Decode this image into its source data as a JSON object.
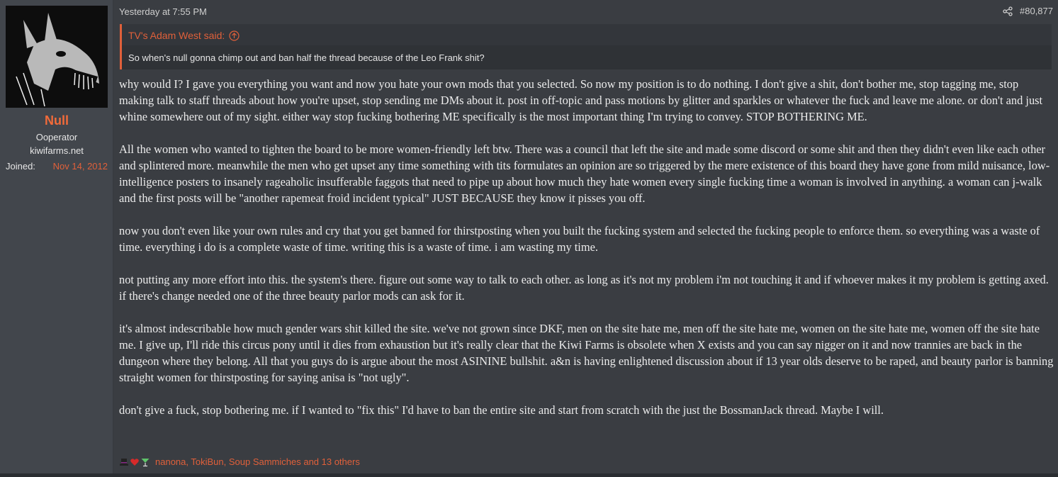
{
  "user": {
    "name": "Null",
    "title": "Ooperator",
    "banner": "kiwifarms.net",
    "joined_label": "Joined:",
    "joined_value": "Nov 14, 2012"
  },
  "post": {
    "date": "Yesterday at 7:55 PM",
    "number": "#80,877",
    "quote_author": "TV's Adam West said:",
    "quote_text": "So when's null gonna chimp out and ban half the thread because of the Leo Frank shit?",
    "paragraphs": [
      "why would I? I gave you everything you want and now you hate your own mods that you selected. So now my position is to do nothing. I don't give a shit, don't bother me, stop tagging me, stop making talk to staff threads about how you're upset, stop sending me DMs about it. post in off-topic and pass motions by glitter and sparkles or whatever the fuck and leave me alone. or don't and just whine somewhere out of my sight. either way stop fucking bothering ME specifically is the most important thing I'm trying to convey. STOP BOTHERING ME.",
      "All the women who wanted to tighten the board to be more women-friendly left btw. There was a council that left the site and made some discord or some shit and then they didn't even like each other and splintered more. meanwhile the men who get upset any time something with tits formulates an opinion are so triggered by the mere existence of this board they have gone from mild nuisance, low-intelligence posters to insanely rageaholic insufferable faggots that need to pipe up about how much they hate women every single fucking time a woman is involved in anything. a woman can j-walk and the first posts will be \"another rapemeat froid incident typical\" JUST BECAUSE they know it pisses you off.",
      "now you don't even like your own rules and cry that you get banned for thirstposting when you built the fucking system and selected the fucking people to enforce them. so everything was a waste of time. everything i do is a complete waste of time. writing this is a waste of time. i am wasting my time.",
      "not putting any more effort into this. the system's there. figure out some way to talk to each other. as long as it's not my problem i'm not touching it and if whoever makes it my problem is getting axed. if there's change needed one of the three beauty parlor mods can ask for it.",
      "it's almost indescribable how much gender wars shit killed the site. we've not grown since DKF, men on the site hate me, men off the site hate me, women on the site hate me, women off the site hate me. I give up, I'll ride this circus pony until it dies from exhaustion but it's really clear that the Kiwi Farms is obsolete when X exists and you can say nigger on it and now trannies are back in the dungeon where they belong. All that you guys do is argue about the most ASININE bullshit. a&n is having enlightened discussion about if 13 year olds deserve to be raped, and beauty parlor is banning straight women for thirstposting for saying anisa is \"not ugly\".",
      "don't give a fuck, stop bothering me. if I wanted to \"fix this\" I'd have to ban the entire site and start from scratch with the just the BossmanJack thread. Maybe I will."
    ],
    "reactions_users": "nanona, TokiBun, Soup Sammiches and 13 others",
    "reaction_icons": [
      "top-hat-icon",
      "heart-icon",
      "cocktail-icon"
    ]
  },
  "colors": {
    "accent": "#e0603a",
    "username": "#f26b3a",
    "background": "#3a3d42",
    "sidebar": "#42464c"
  }
}
